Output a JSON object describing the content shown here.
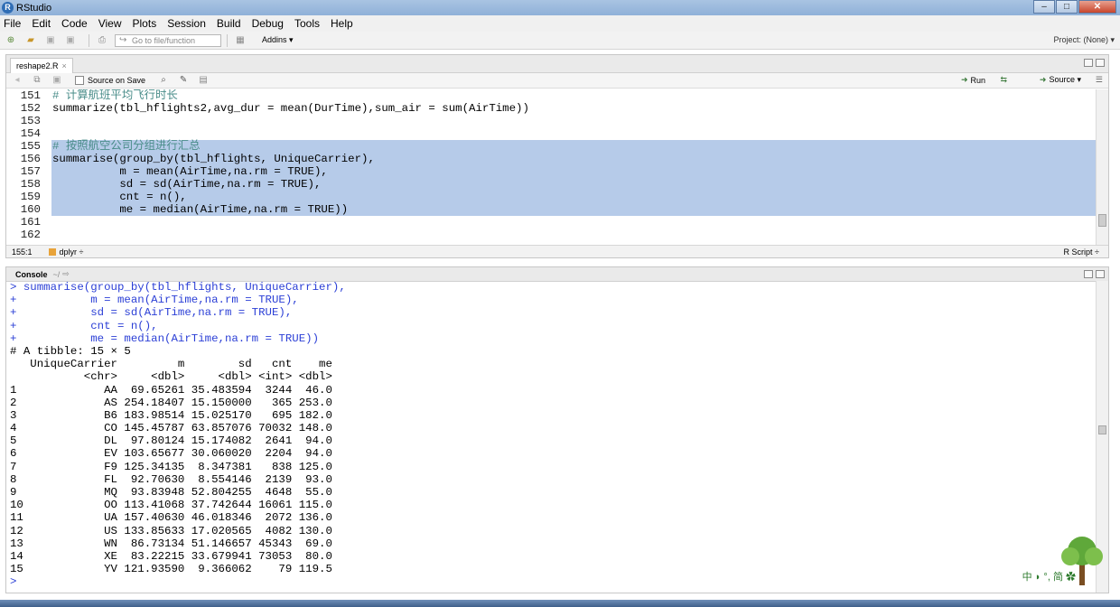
{
  "window": {
    "title": "RStudio",
    "min": "–",
    "max": "□",
    "close": "✕"
  },
  "menu": [
    "File",
    "Edit",
    "Code",
    "View",
    "Plots",
    "Session",
    "Build",
    "Debug",
    "Tools",
    "Help"
  ],
  "toolbar": {
    "goto_placeholder": "Go to file/function",
    "addins": "Addins ▾",
    "project": "Project: (None) ▾"
  },
  "editor": {
    "tab_label": "reshape2.R",
    "source_on_save": "Source on Save",
    "run": "Run",
    "source": "Source",
    "cursor_pos": "155:1",
    "chunk": "dplyr ÷",
    "file_type": "R Script ÷",
    "lines": [
      {
        "n": "151",
        "text": "# 计算航班平均飞行时长",
        "comment": true,
        "selected": false
      },
      {
        "n": "152",
        "text": "summarize(tbl_hflights2,avg_dur = mean(DurTime),sum_air = sum(AirTime))",
        "comment": false,
        "selected": false
      },
      {
        "n": "153",
        "text": "",
        "comment": false,
        "selected": false
      },
      {
        "n": "154",
        "text": "",
        "comment": false,
        "selected": false
      },
      {
        "n": "155",
        "text": "# 按照航空公司分组进行汇总",
        "comment": true,
        "selected": true
      },
      {
        "n": "156",
        "text": "summarise(group_by(tbl_hflights, UniqueCarrier),",
        "comment": false,
        "selected": true
      },
      {
        "n": "157",
        "text": "          m = mean(AirTime,na.rm = TRUE),",
        "comment": false,
        "selected": true
      },
      {
        "n": "158",
        "text": "          sd = sd(AirTime,na.rm = TRUE),",
        "comment": false,
        "selected": true
      },
      {
        "n": "159",
        "text": "          cnt = n(),",
        "comment": false,
        "selected": true
      },
      {
        "n": "160",
        "text": "          me = median(AirTime,na.rm = TRUE))",
        "comment": false,
        "selected": true
      },
      {
        "n": "161",
        "text": "",
        "comment": false,
        "selected": false
      },
      {
        "n": "162",
        "text": "",
        "comment": false,
        "selected": false
      }
    ]
  },
  "console": {
    "title": "Console",
    "path": "~/",
    "lines": [
      {
        "t": "> summarise(group_by(tbl_hflights, UniqueCarrier),",
        "cls": "cmd"
      },
      {
        "t": "+           m = mean(AirTime,na.rm = TRUE),",
        "cls": "cmd"
      },
      {
        "t": "+           sd = sd(AirTime,na.rm = TRUE),",
        "cls": "cmd"
      },
      {
        "t": "+           cnt = n(),",
        "cls": "cmd"
      },
      {
        "t": "+           me = median(AirTime,na.rm = TRUE))",
        "cls": "cmd"
      },
      {
        "t": "# A tibble: 15 × 5",
        "cls": "out"
      },
      {
        "t": "   UniqueCarrier         m        sd   cnt    me",
        "cls": "out"
      },
      {
        "t": "           <chr>     <dbl>     <dbl> <int> <dbl>",
        "cls": "out"
      },
      {
        "t": "1             AA  69.65261 35.483594  3244  46.0",
        "cls": "out"
      },
      {
        "t": "2             AS 254.18407 15.150000   365 253.0",
        "cls": "out"
      },
      {
        "t": "3             B6 183.98514 15.025170   695 182.0",
        "cls": "out"
      },
      {
        "t": "4             CO 145.45787 63.857076 70032 148.0",
        "cls": "out"
      },
      {
        "t": "5             DL  97.80124 15.174082  2641  94.0",
        "cls": "out"
      },
      {
        "t": "6             EV 103.65677 30.060020  2204  94.0",
        "cls": "out"
      },
      {
        "t": "7             F9 125.34135  8.347381   838 125.0",
        "cls": "out"
      },
      {
        "t": "8             FL  92.70630  8.554146  2139  93.0",
        "cls": "out"
      },
      {
        "t": "9             MQ  93.83948 52.804255  4648  55.0",
        "cls": "out"
      },
      {
        "t": "10            OO 113.41068 37.742644 16061 115.0",
        "cls": "out"
      },
      {
        "t": "11            UA 157.40630 46.018346  2072 136.0",
        "cls": "out"
      },
      {
        "t": "12            US 133.85633 17.020565  4082 130.0",
        "cls": "out"
      },
      {
        "t": "13            WN  86.73134 51.146657 45343  69.0",
        "cls": "out"
      },
      {
        "t": "14            XE  83.22215 33.679941 73053  80.0",
        "cls": "out"
      },
      {
        "t": "15            YV 121.93590  9.366062    79 119.5",
        "cls": "out"
      },
      {
        "t": ">",
        "cls": "prompt"
      }
    ]
  },
  "ime": "中 ◗ °, 简 ✿"
}
